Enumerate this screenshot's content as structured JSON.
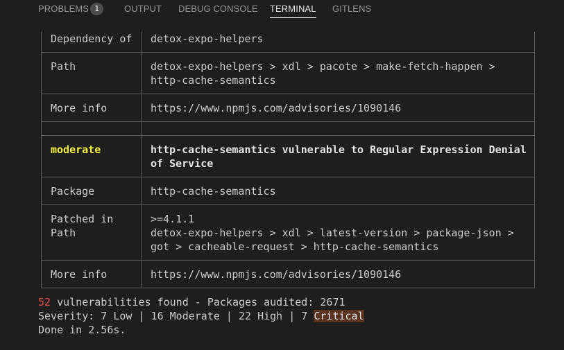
{
  "panel_tabs": [
    {
      "label": "PROBLEMS",
      "badge": "1"
    },
    {
      "label": "OUTPUT"
    },
    {
      "label": "DEBUG CONSOLE"
    },
    {
      "label": "TERMINAL",
      "active": true
    },
    {
      "label": "GITLENS"
    }
  ],
  "table1": {
    "rows": [
      {
        "label": "Dependency of",
        "value": "detox-expo-helpers"
      },
      {
        "label": "Path",
        "value_line1": "detox-expo-helpers > xdl > pacote > make-fetch-happen >",
        "value_line2": "http-cache-semantics"
      },
      {
        "label": "More info",
        "value": "https://www.npmjs.com/advisories/1090146"
      }
    ]
  },
  "table2": {
    "severity": "moderate",
    "title_line1": "http-cache-semantics vulnerable to Regular Expression Denial",
    "title_line2": "of Service",
    "package_label": "Package",
    "package_value": "http-cache-semantics",
    "patched_label": "Patched in",
    "path_label": "Path",
    "patched_value": ">=4.1.1",
    "path_line1": "detox-expo-helpers > xdl > latest-version > package-json >",
    "path_line2": "got > cacheable-request > http-cache-semantics",
    "more_info_label": "More info",
    "more_info_value": "https://www.npmjs.com/advisories/1090146"
  },
  "summary": {
    "vuln_count": "52",
    "vuln_rest": " vulnerabilities found - Packages audited: 2671",
    "severity_prefix": "Severity: 7 Low | 16 Moderate | 22 High | 7 ",
    "critical": "Critical",
    "done": "Done in 2.56s."
  },
  "colors": {
    "background": "#1e1e1e",
    "border": "#5a5a5a",
    "moderate": "#f5f543",
    "count_red": "#f14c4c",
    "critical_bg": "#5a3320"
  }
}
